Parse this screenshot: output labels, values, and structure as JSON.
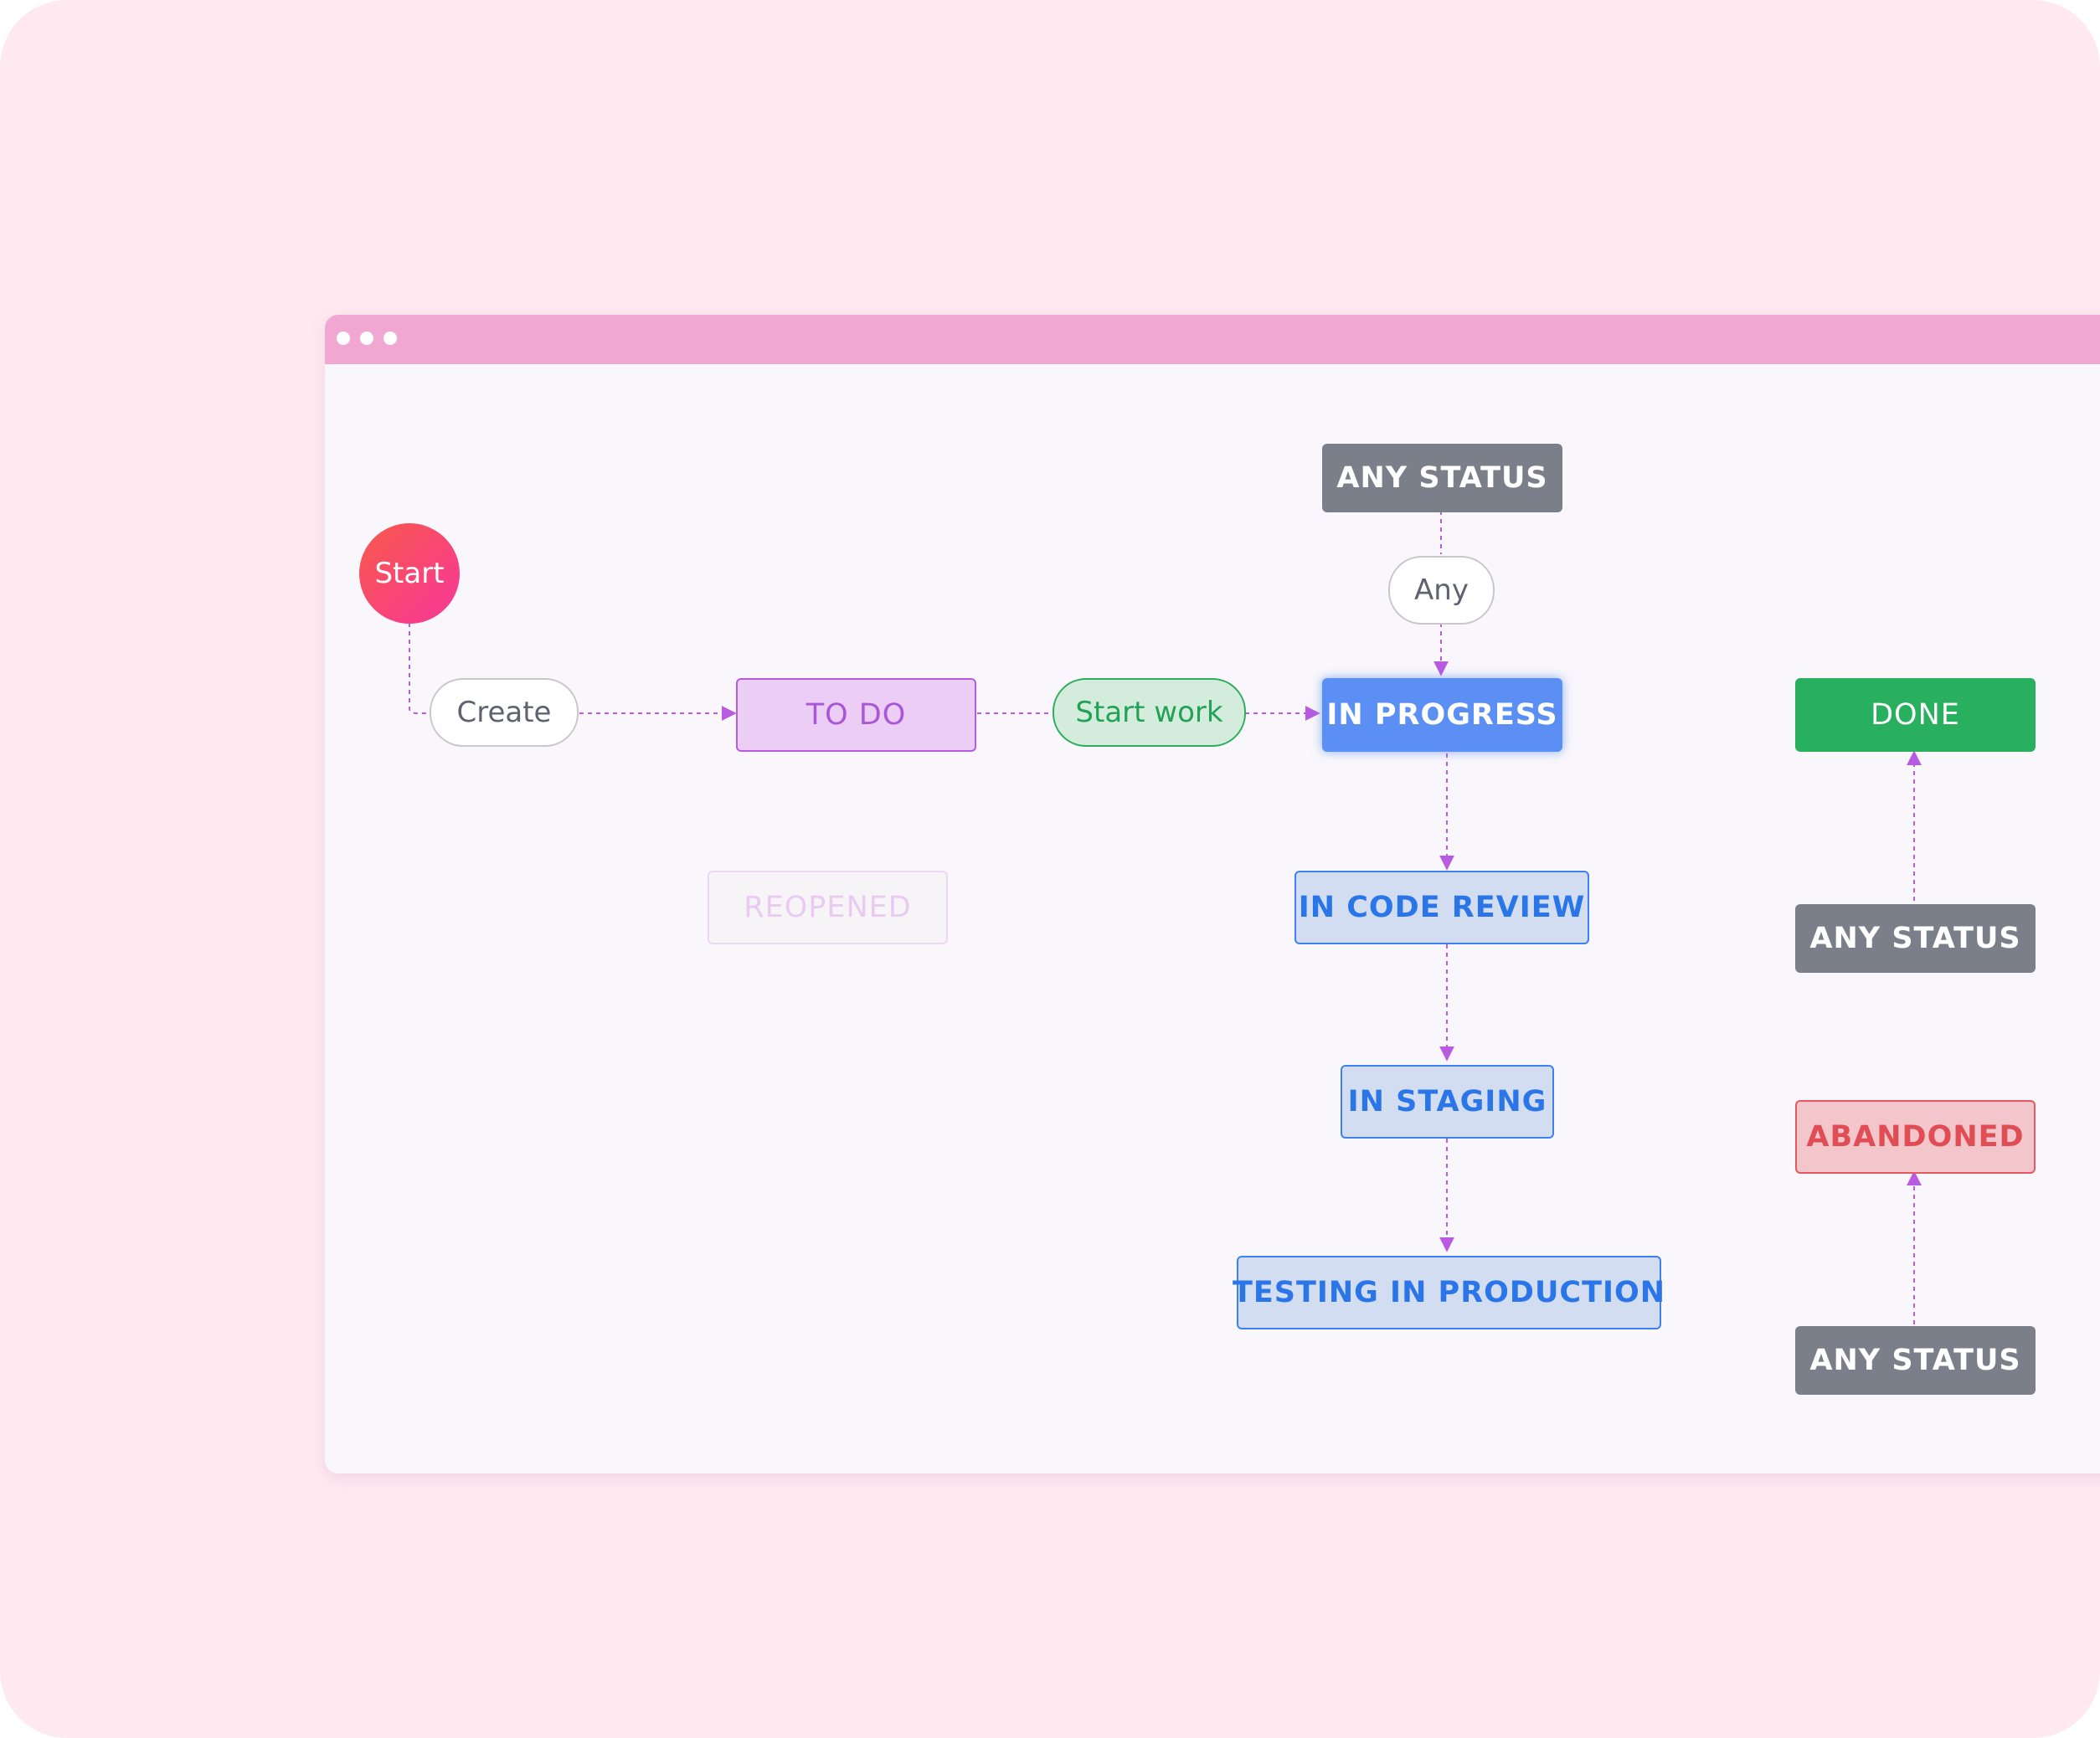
{
  "window": {
    "dots": [
      "dot",
      "dot",
      "dot"
    ]
  },
  "start": {
    "label": "Start"
  },
  "transitions": {
    "create": "Create",
    "start_work": "Start work",
    "any": "Any"
  },
  "statuses": {
    "any_status_top": "ANY STATUS",
    "todo": "TO DO",
    "in_progress": "IN PROGRESS",
    "done": "DONE",
    "reopened": "REOPENED",
    "in_code_review": "IN CODE REVIEW",
    "any_status_right_mid": "ANY STATUS",
    "in_staging": "IN STAGING",
    "abandoned": "ABANDONED",
    "testing_in_production": "TESTING IN PRODUCTION",
    "any_status_right_bottom": "ANY STATUS"
  },
  "colors": {
    "background": "#ffe9f1",
    "titlebar": "#f0a8d2",
    "connector": "#b85be0",
    "gray_status": "#7b7f89",
    "in_progress": "#5b8ff3",
    "done": "#29b05f",
    "abandoned": "#e14d55",
    "todo": "#a957d6"
  }
}
